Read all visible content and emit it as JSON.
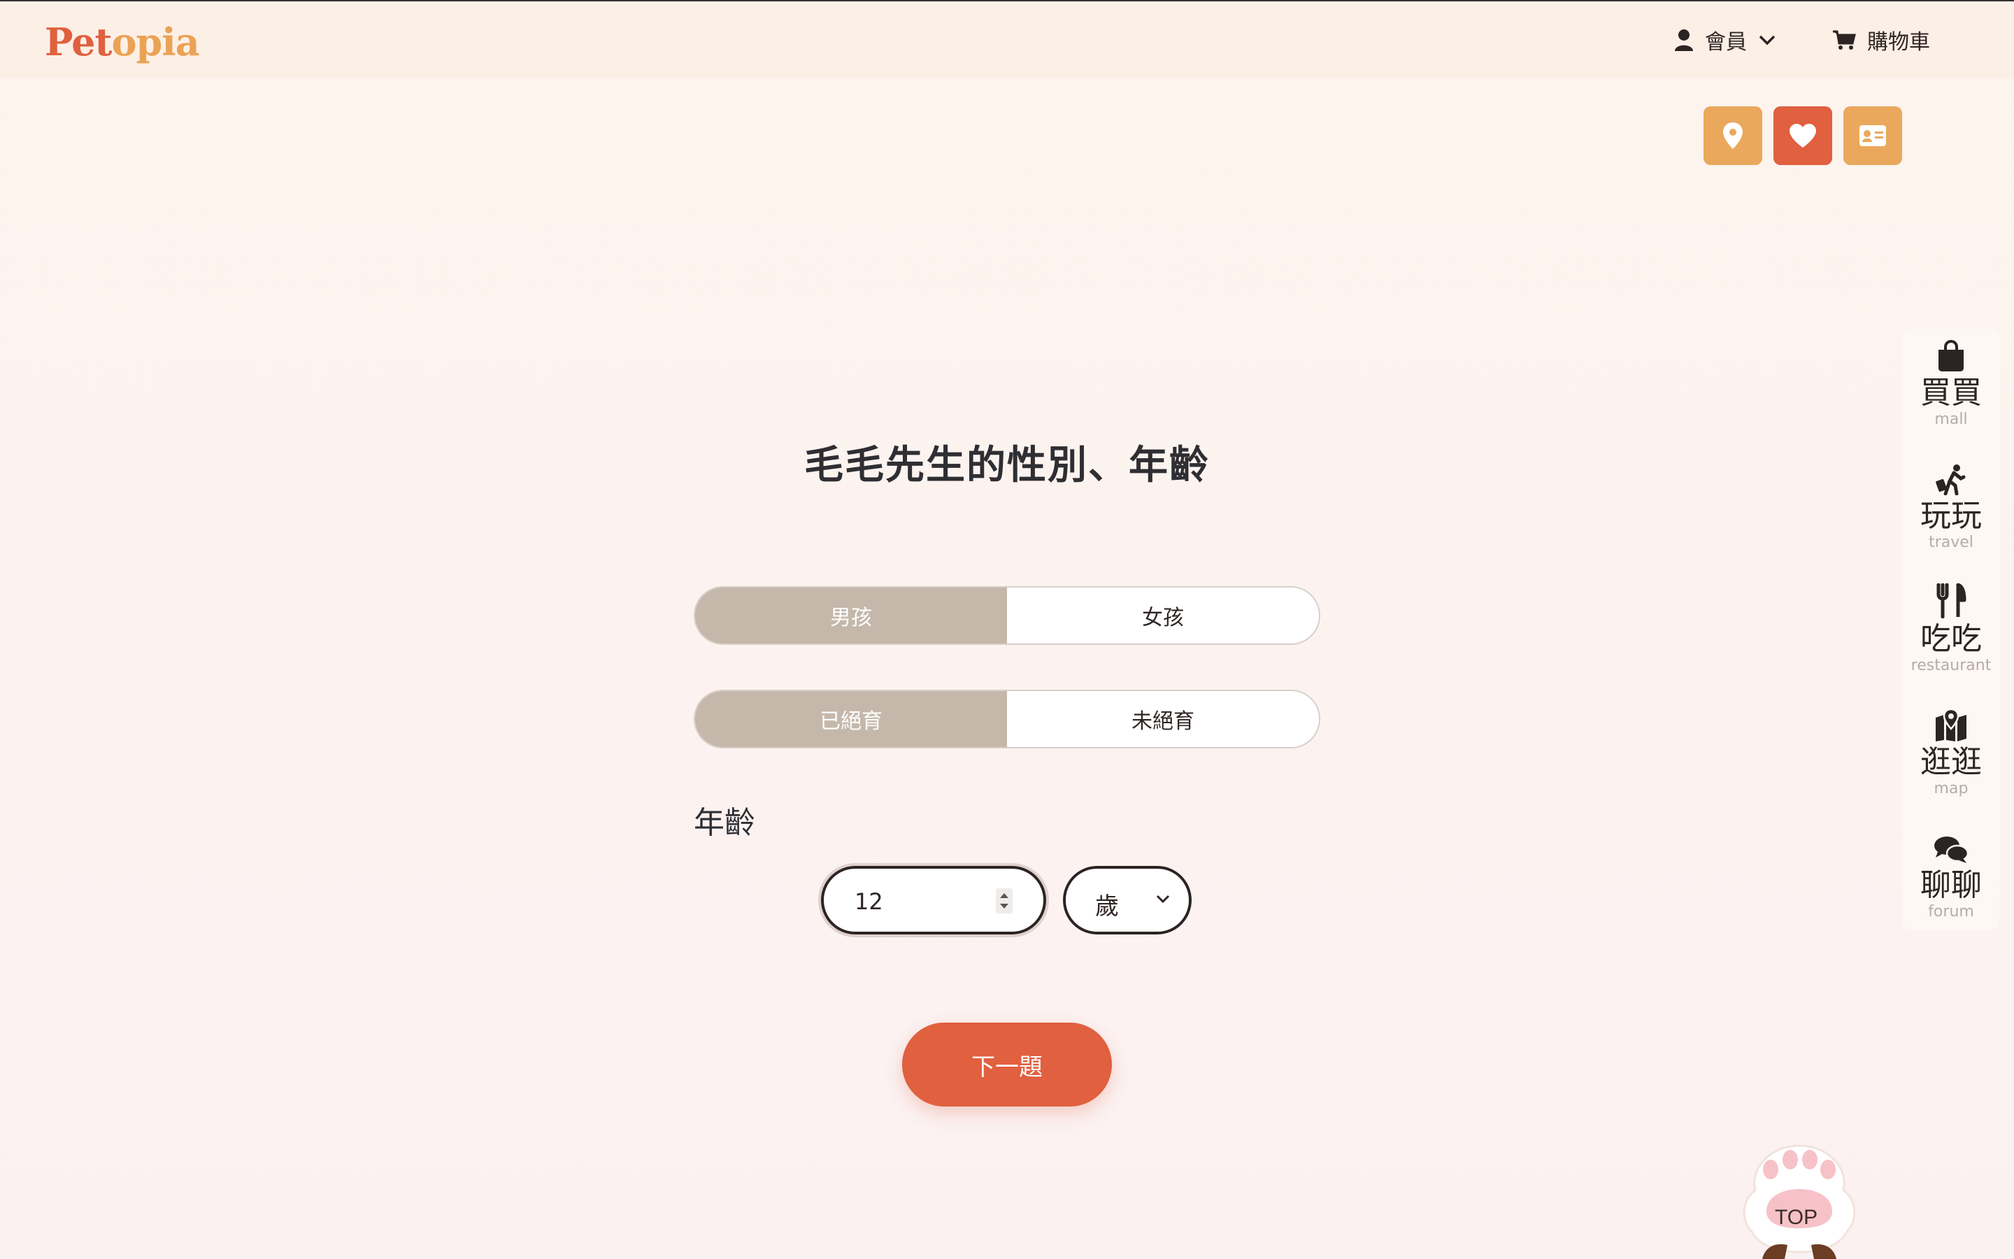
{
  "header": {
    "logo_a": "Pet",
    "logo_b": "opia",
    "member_label": "會員",
    "cart_label": "購物車"
  },
  "quick_buttons": [
    "location-icon",
    "heart-icon",
    "id-card-icon"
  ],
  "sidebar": {
    "items": [
      {
        "zh": "買買",
        "en": "mall",
        "icon": "shopping-bag-icon"
      },
      {
        "zh": "玩玩",
        "en": "travel",
        "icon": "travel-icon"
      },
      {
        "zh": "吃吃",
        "en": "restaurant",
        "icon": "utensils-icon"
      },
      {
        "zh": "逛逛",
        "en": "map",
        "icon": "map-icon"
      },
      {
        "zh": "聊聊",
        "en": "forum",
        "icon": "chat-icon"
      }
    ]
  },
  "main": {
    "title": "毛毛先生的性別、年齡",
    "gender": {
      "options": [
        "男孩",
        "女孩"
      ],
      "selected": "男孩"
    },
    "neuter": {
      "options": [
        "已絕育",
        "未絕育"
      ],
      "selected": "已絕育"
    },
    "age_label": "年齡",
    "age_value": "12",
    "age_unit": "歲",
    "next_label": "下一題"
  },
  "top_button": {
    "label": "TOP"
  },
  "colors": {
    "accent": "#e0603f",
    "accent_light": "#eaa85c",
    "toggle_selected": "#c5b8ab"
  }
}
